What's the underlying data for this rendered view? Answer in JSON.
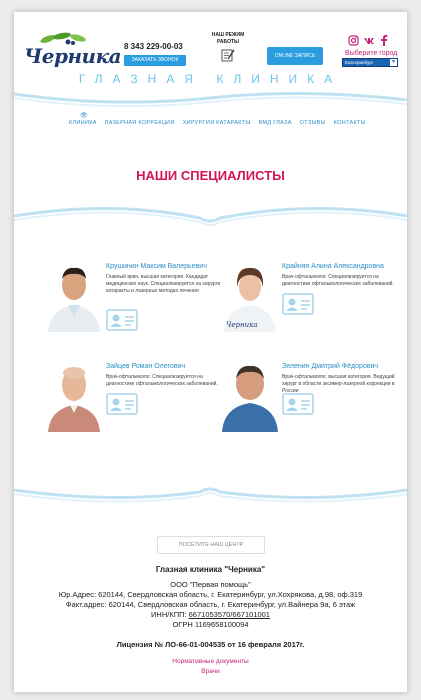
{
  "header": {
    "logo_text": "Черника",
    "phone": "8 343 229-00-03",
    "call_button": "Заказать звонок",
    "schedule_title": "Наш режим работы",
    "online_button": "Online запись",
    "city_label": "Выберите город",
    "city_selected": "Екатеринбург",
    "tagline": "Глазная клиника",
    "socials": [
      "instagram-icon",
      "vk-icon",
      "facebook-icon"
    ]
  },
  "nav": {
    "items": [
      "Клиника",
      "Лазерная коррекция",
      "Хирургия катаракты",
      "ВМД глаза",
      "Отзывы",
      "Контакты"
    ]
  },
  "section_title": "Наши специалисты",
  "doctors": [
    {
      "name": "Крушинин Максим Валерьевич",
      "desc": "Главный врач, высшая категория. Кандидат медицинских наук. Специализируется на хирургии катаракты и лазерных методах лечения"
    },
    {
      "name": "Крайняя Алина Александровна",
      "desc": "Врач-офтальмолог. Специализируется на диагностике офтальмологических заболеваний."
    },
    {
      "name": "Зайцев Роман Олегович",
      "desc": "Врач-офтальмолог. Специализируется на диагностике офтальмологических заболеваний."
    },
    {
      "name": "Зеленин Дмитрий Фёдорович",
      "desc": "Врач-офтальмолог, высшая категория. Ведущий хирург в области эксимер-лазерной коррекции в России"
    }
  ],
  "footer": {
    "visit_button": "Посетите наш центр",
    "clinic_name": "Глазная клиника \"Черника\"",
    "company": "ООО \"Первая помощь\"",
    "legal_address": "Юр.Адрес: 620144, Свердловская область, г. Екатеринбург, ул.Хохрякова, д.98, оф.319",
    "actual_address": "Факт.адрес: 620144, Свердловская область, г. Екатеринбург, ул.Вайнера 9а, 6 этаж",
    "inn_label": "ИНН/КПП: ",
    "inn_value": "6671053570/667101001",
    "ogrn": "ОГРН 1169658100094",
    "license": "Лицензия № ЛО-66-01-004535 от 16 февраля 2017г.",
    "docs_link": "Нормативные документы",
    "doctors_link": "Врачи"
  },
  "colors": {
    "accent_blue": "#2a9de0",
    "brand_pink": "#d4145a",
    "tagline_blue": "#6ec5ea"
  }
}
